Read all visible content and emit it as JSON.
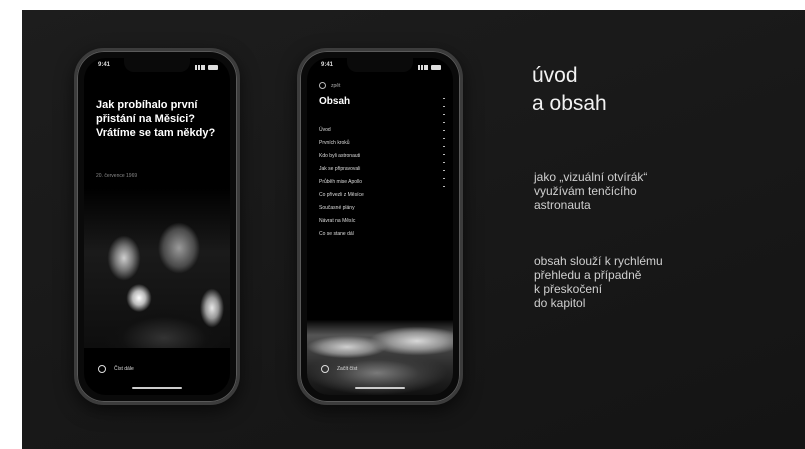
{
  "slide": {
    "heading_line1": "úvod",
    "heading_line2": "a obsah",
    "paragraph1": "jako „vizuální otvírák“\nvyužívám tenčícího\nastronauta",
    "paragraph2": "obsah slouží k rychlému\npřehledu a případně\nk přeskočení\ndo kapitol"
  },
  "phone1": {
    "status_time": "9:41",
    "title": "Jak probíhalo první přistání na Měsíci? Vrátíme se tam někdy?",
    "date": "20. července 1969",
    "photo_icon": "astronaut-photo",
    "bottom_icon": "circle-icon",
    "bottom_label": "Číst dále"
  },
  "phone2": {
    "status_time": "9:41",
    "back_label": "zpět",
    "title": "Obsah",
    "toc": [
      "Úvod",
      "Prvních kroků",
      "Kdo byli astronauti",
      "Jak se připravovali",
      "Průběh mise Apollo",
      "Co přivezli z Měsíce",
      "Současné plány",
      "Návrat na Měsíc",
      "Co se stane dál"
    ],
    "moon_icon": "moon-surface-photo",
    "bottom_icon": "circle-icon",
    "bottom_label": "Začít číst"
  }
}
